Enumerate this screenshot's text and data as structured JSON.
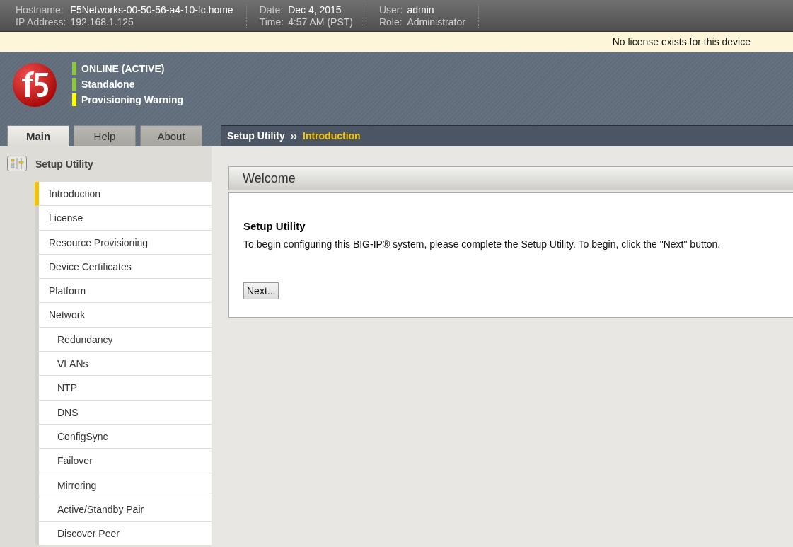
{
  "header": {
    "fields": [
      {
        "label": "Hostname:",
        "value": "F5Networks-00-50-56-a4-10-fc.home"
      },
      {
        "label": "IP Address:",
        "value": "192.168.1.125"
      }
    ],
    "fields_2": [
      {
        "label": "Date:",
        "value": "Dec 4, 2015"
      },
      {
        "label": "Time:",
        "value": "4:57 AM (PST)"
      }
    ],
    "fields_3": [
      {
        "label": "User:",
        "value": "admin"
      },
      {
        "label": "Role:",
        "value": "Administrator"
      }
    ]
  },
  "notice": "No license exists for this device",
  "status": [
    {
      "text": "ONLINE (ACTIVE)",
      "color": "#8dc63f"
    },
    {
      "text": "Standalone",
      "color": "#8dc63f"
    },
    {
      "text": "Provisioning Warning",
      "color": "#ffff00"
    }
  ],
  "tabs": [
    {
      "label": "Main",
      "selected": true
    },
    {
      "label": "Help",
      "selected": false
    },
    {
      "label": "About",
      "selected": false
    }
  ],
  "breadcrumb": {
    "parent": "Setup Utility",
    "separator": "››",
    "current": "Introduction"
  },
  "sidebar": {
    "title": "Setup Utility",
    "items": [
      {
        "label": "Introduction",
        "selected": true
      },
      {
        "label": "License",
        "selected": false
      },
      {
        "label": "Resource Provisioning",
        "selected": false
      },
      {
        "label": "Device Certificates",
        "selected": false
      },
      {
        "label": "Platform",
        "selected": false
      },
      {
        "label": "Network",
        "selected": false,
        "children": [
          {
            "label": "Redundancy",
            "selected": false
          },
          {
            "label": "VLANs",
            "selected": false
          },
          {
            "label": "NTP",
            "selected": false
          },
          {
            "label": "DNS",
            "selected": false
          },
          {
            "label": "ConfigSync",
            "selected": false
          },
          {
            "label": "Failover",
            "selected": false
          },
          {
            "label": "Mirroring",
            "selected": false
          },
          {
            "label": "Active/Standby Pair",
            "selected": false
          },
          {
            "label": "Discover Peer",
            "selected": false
          }
        ]
      }
    ]
  },
  "panel": {
    "title": "Welcome",
    "heading": "Setup Utility",
    "body": "To begin configuring this BIG-IP® system, please complete the Setup Utility. To begin, click the \"Next\" button.",
    "button": "Next..."
  }
}
